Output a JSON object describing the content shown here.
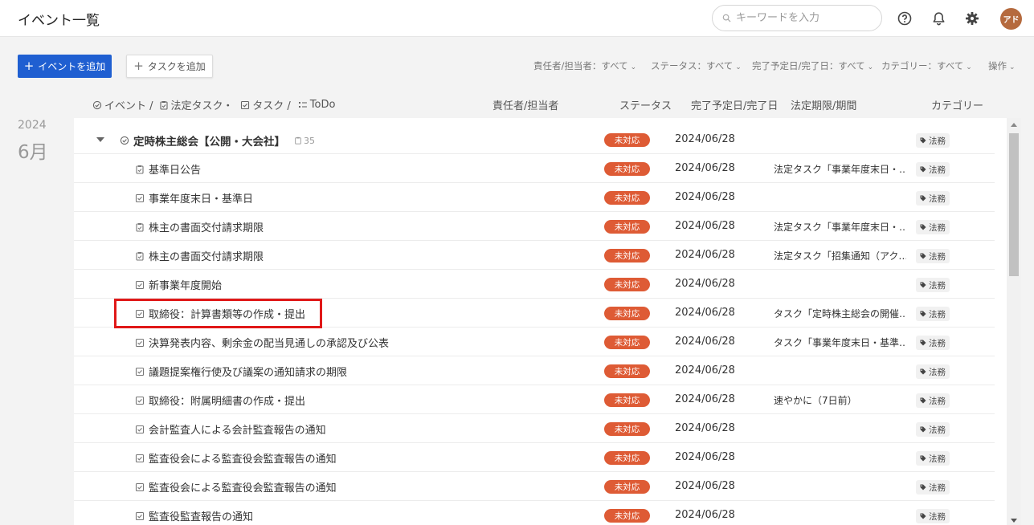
{
  "header": {
    "title": "イベント一覧",
    "search_placeholder": "キーワードを入力",
    "avatar_text": "アド"
  },
  "toolbar": {
    "add_event_label": "イベントを追加",
    "add_task_label": "タスクを追加",
    "filters": [
      "責任者/担当者：すべて",
      "ステータス：すべて",
      "完了予定日/完了日：すべて",
      "カテゴリー：すべて",
      "操作"
    ]
  },
  "columns": {
    "type_event": "イベント /",
    "type_legal": "法定タスク・",
    "type_task": "タスク /",
    "type_todo": "ToDo",
    "owner": "責任者/担当者",
    "status": "ステータス",
    "due": "完了予定日/完了日",
    "deadline": "法定期限/期間",
    "category": "カテゴリー"
  },
  "date_group": {
    "year": "2024",
    "month": "6月"
  },
  "event": {
    "title": "定時株主総会【公開・大会社】",
    "count": "35",
    "status": "未対応",
    "due": "2024/06/28",
    "deadline": "",
    "category": "法務"
  },
  "rows": [
    {
      "icon": "legal-task-icon",
      "title": "基準日公告",
      "status": "未対応",
      "due": "2024/06/28",
      "deadline": "法定タスク「事業年度末日・…",
      "category": "法務"
    },
    {
      "icon": "task-icon",
      "title": "事業年度末日・基準日",
      "status": "未対応",
      "due": "2024/06/28",
      "deadline": "",
      "category": "法務"
    },
    {
      "icon": "legal-task-icon",
      "title": "株主の書面交付請求期限",
      "status": "未対応",
      "due": "2024/06/28",
      "deadline": "法定タスク「事業年度末日・…",
      "category": "法務"
    },
    {
      "icon": "legal-task-icon",
      "title": "株主の書面交付請求期限",
      "status": "未対応",
      "due": "2024/06/28",
      "deadline": "法定タスク「招集通知（アク…",
      "category": "法務"
    },
    {
      "icon": "task-icon",
      "title": "新事業年度開始",
      "status": "未対応",
      "due": "2024/06/28",
      "deadline": "",
      "category": "法務"
    },
    {
      "icon": "task-icon",
      "title": "取締役：計算書類等の作成・提出",
      "status": "未対応",
      "due": "2024/06/28",
      "deadline": "タスク「定時株主総会の開催…",
      "category": "法務"
    },
    {
      "icon": "task-icon",
      "title": "決算発表内容、剰余金の配当見通しの承認及び公表",
      "status": "未対応",
      "due": "2024/06/28",
      "deadline": "タスク「事業年度末日・基準…",
      "category": "法務"
    },
    {
      "icon": "task-icon",
      "title": "議題提案権行使及び議案の通知請求の期限",
      "status": "未対応",
      "due": "2024/06/28",
      "deadline": "",
      "category": "法務"
    },
    {
      "icon": "task-icon",
      "title": "取締役：附属明細書の作成・提出",
      "status": "未対応",
      "due": "2024/06/28",
      "deadline": "速やかに（7日前）",
      "category": "法務"
    },
    {
      "icon": "task-icon",
      "title": "会計監査人による会計監査報告の通知",
      "status": "未対応",
      "due": "2024/06/28",
      "deadline": "",
      "category": "法務"
    },
    {
      "icon": "task-icon",
      "title": "監査役会による監査役会監査報告の通知",
      "status": "未対応",
      "due": "2024/06/28",
      "deadline": "",
      "category": "法務"
    },
    {
      "icon": "task-icon",
      "title": "監査役会による監査役会監査報告の通知",
      "status": "未対応",
      "due": "2024/06/28",
      "deadline": "",
      "category": "法務"
    },
    {
      "icon": "task-icon",
      "title": "監査役監査報告の通知",
      "status": "未対応",
      "due": "2024/06/28",
      "deadline": "",
      "category": "法務"
    }
  ],
  "colors": {
    "primary": "#1f5fd1",
    "status_badge": "#de5b35",
    "highlight_box": "#e01818"
  }
}
